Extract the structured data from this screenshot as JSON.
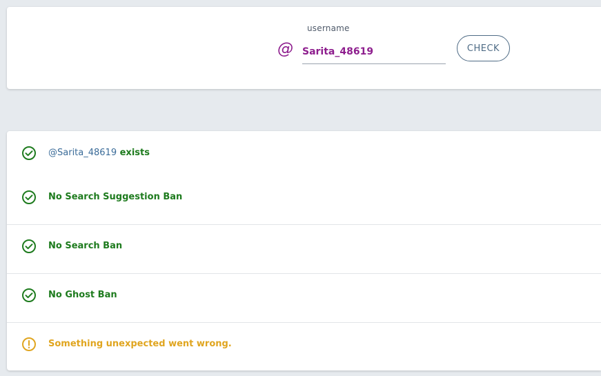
{
  "search": {
    "label": "username",
    "at_symbol": "@",
    "value": "Sarita_48619",
    "button_label": "CHECK"
  },
  "results": {
    "exists_handle": "@Sarita_48619",
    "exists_suffix": " exists",
    "items": [
      {
        "label": "No Search Suggestion Ban",
        "status": "ok",
        "icon": "check-circle-icon"
      },
      {
        "label": "No Search Ban",
        "status": "ok",
        "icon": "check-circle-icon"
      },
      {
        "label": "No Ghost Ban",
        "status": "ok",
        "icon": "check-circle-icon"
      },
      {
        "label": "Something unexpected went wrong.",
        "status": "warning",
        "icon": "exclamation-circle-icon"
      }
    ]
  },
  "colors": {
    "ok": "#1e7b1e",
    "warning": "#e0a51f",
    "accent": "#8e1e8e",
    "button": "#4e6b85"
  }
}
